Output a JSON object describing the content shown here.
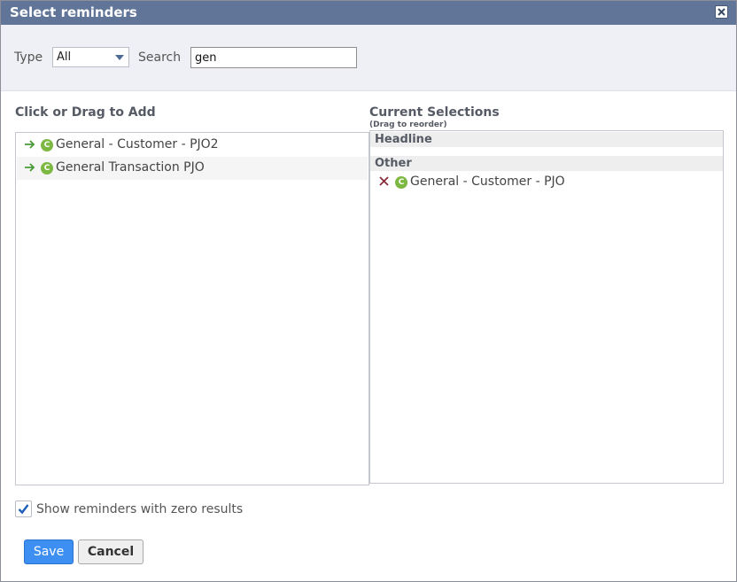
{
  "dialog": {
    "title": "Select reminders",
    "close_icon": "close-icon"
  },
  "filters": {
    "type_label": "Type",
    "type_value": "All",
    "search_label": "Search",
    "search_value": "gen"
  },
  "available": {
    "heading": "Click or Drag to Add",
    "items": [
      {
        "label": "General - Customer - PJO2",
        "badge": "C",
        "icon": "add-arrow-icon"
      },
      {
        "label": "General Transaction PJO",
        "badge": "C",
        "icon": "add-arrow-icon"
      }
    ]
  },
  "selections": {
    "heading": "Current Selections",
    "subheading": "(Drag to reorder)",
    "groups": [
      {
        "name": "Headline",
        "items": []
      },
      {
        "name": "Other",
        "items": [
          {
            "label": "General - Customer - PJO",
            "badge": "C",
            "icon": "remove-x-icon"
          }
        ]
      }
    ]
  },
  "options": {
    "show_zero_label": "Show reminders with zero results",
    "show_zero_checked": true
  },
  "actions": {
    "save_label": "Save",
    "cancel_label": "Cancel"
  },
  "colors": {
    "titlebar": "#607598",
    "filter_bar": "#eef0f5",
    "badge_green": "#7cb842",
    "save_blue": "#3d8ff2",
    "arrow_green": "#4a9a3a",
    "remove_red": "#8b2b3b"
  }
}
